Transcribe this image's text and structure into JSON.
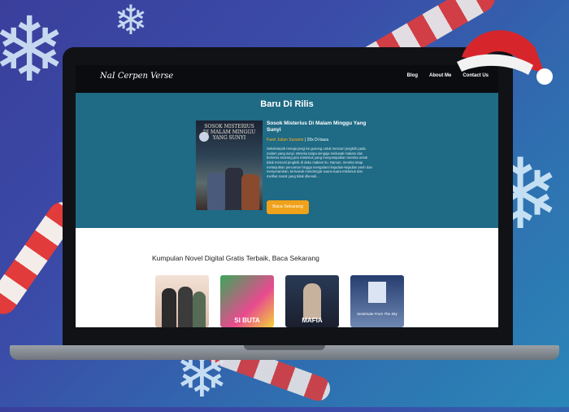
{
  "site": {
    "logo": "NaI Cerpen Verse"
  },
  "nav": {
    "items": [
      "Blog",
      "About Me",
      "Contact Us"
    ]
  },
  "hero": {
    "section_title": "Baru Di Rilis",
    "cover_text": "SOSOK MISTERIUS DI MALAM MINGGU YANG SUNYI",
    "book_title": "Sosok Misterius Di Malam Minggu Yang Sunyi",
    "author": "Farel Julian Susanto",
    "reads": "| 20x Di baca",
    "description": "Sekelompok remaja pergi ke gunung untuk mencari jengkrik pada malam yang sunyi. Mereka tanpa sengaja melewati makam dan bertemu seorang pria misterius yang menyampaikan mereka untuk tidak mencari jengkrik di daku makam itu. Namun, mereka tetap melanjutkan pencarian hingga mengalami kejadian-kejadian aneh dan menyeramkan, termasuk mendengar suara-suara misterius dan melihat sosok yang tidak dikenali...",
    "button": "Baca Sekarang"
  },
  "catalog": {
    "title": "Kumpulan Novel Digital Gratis Terbaik, Baca Sekarang",
    "books": [
      {
        "label": "",
        "color": "#f0d9cc"
      },
      {
        "label": "SI BUTA",
        "color": "#3aa75a"
      },
      {
        "label": "MAFIA",
        "color": "#2a3a55"
      },
      {
        "label": "Sentimate From The Sky",
        "color": "#263d6e"
      }
    ]
  },
  "colors": {
    "hero_bg": "#1f6a84",
    "accent": "#f0a21a",
    "nav_bg": "#0b0c0f"
  }
}
